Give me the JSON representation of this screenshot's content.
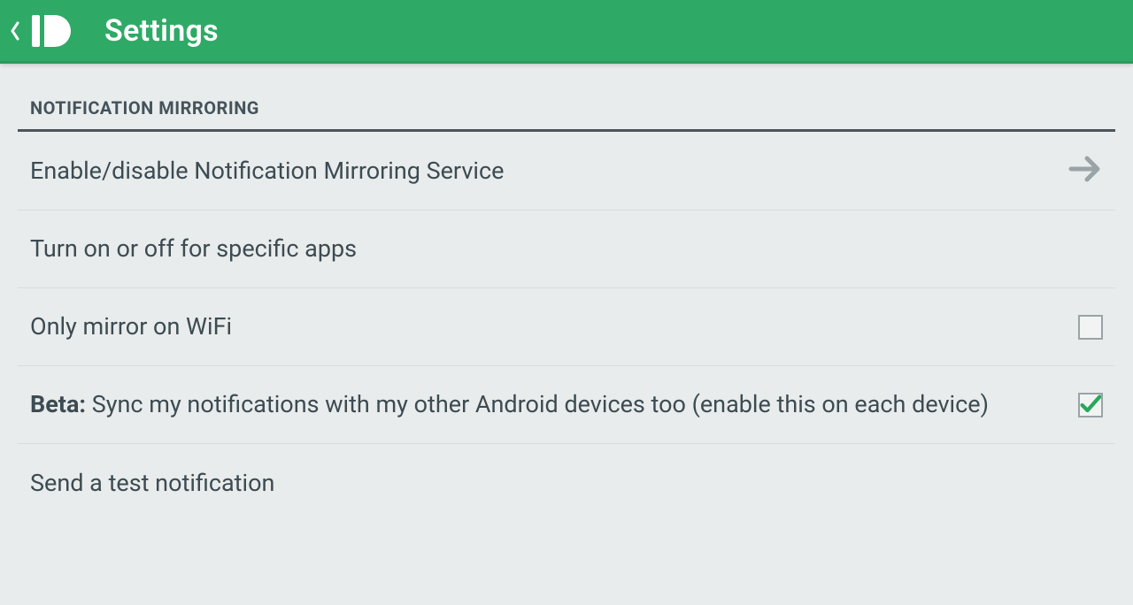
{
  "colors": {
    "brand": "#2eaa66",
    "check": "#29a85c",
    "text": "#3d4b52",
    "header_text": "#44535b",
    "chevron_grey": "#9aa3a6"
  },
  "header": {
    "title": "Settings"
  },
  "section": {
    "label": "NOTIFICATION MIRRORING"
  },
  "rows": {
    "enable_service": "Enable/disable Notification Mirroring Service",
    "specific_apps": "Turn on or off for specific apps",
    "mirror_wifi": "Only mirror on WiFi",
    "beta_prefix": "Beta:",
    "beta_rest": " Sync my notifications with my other Android devices too (enable this on each device)",
    "test_notification": "Send a test notification"
  },
  "checkbox_states": {
    "mirror_wifi": false,
    "beta_sync": true
  }
}
